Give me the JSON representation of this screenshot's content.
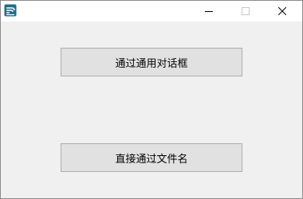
{
  "window": {
    "icon": "app-icon",
    "controls": {
      "minimize_icon": "minimize-icon",
      "maximize_icon": "maximize-icon",
      "close_icon": "close-icon"
    }
  },
  "buttons": {
    "common_dialog_label": "通过通用对话框",
    "direct_filename_label": "直接通过文件名"
  },
  "colors": {
    "client_bg": "#f0f0f0",
    "button_bg": "#e1e1e1",
    "button_border": "#adadad",
    "icon_teal": "#1c6e8a"
  }
}
